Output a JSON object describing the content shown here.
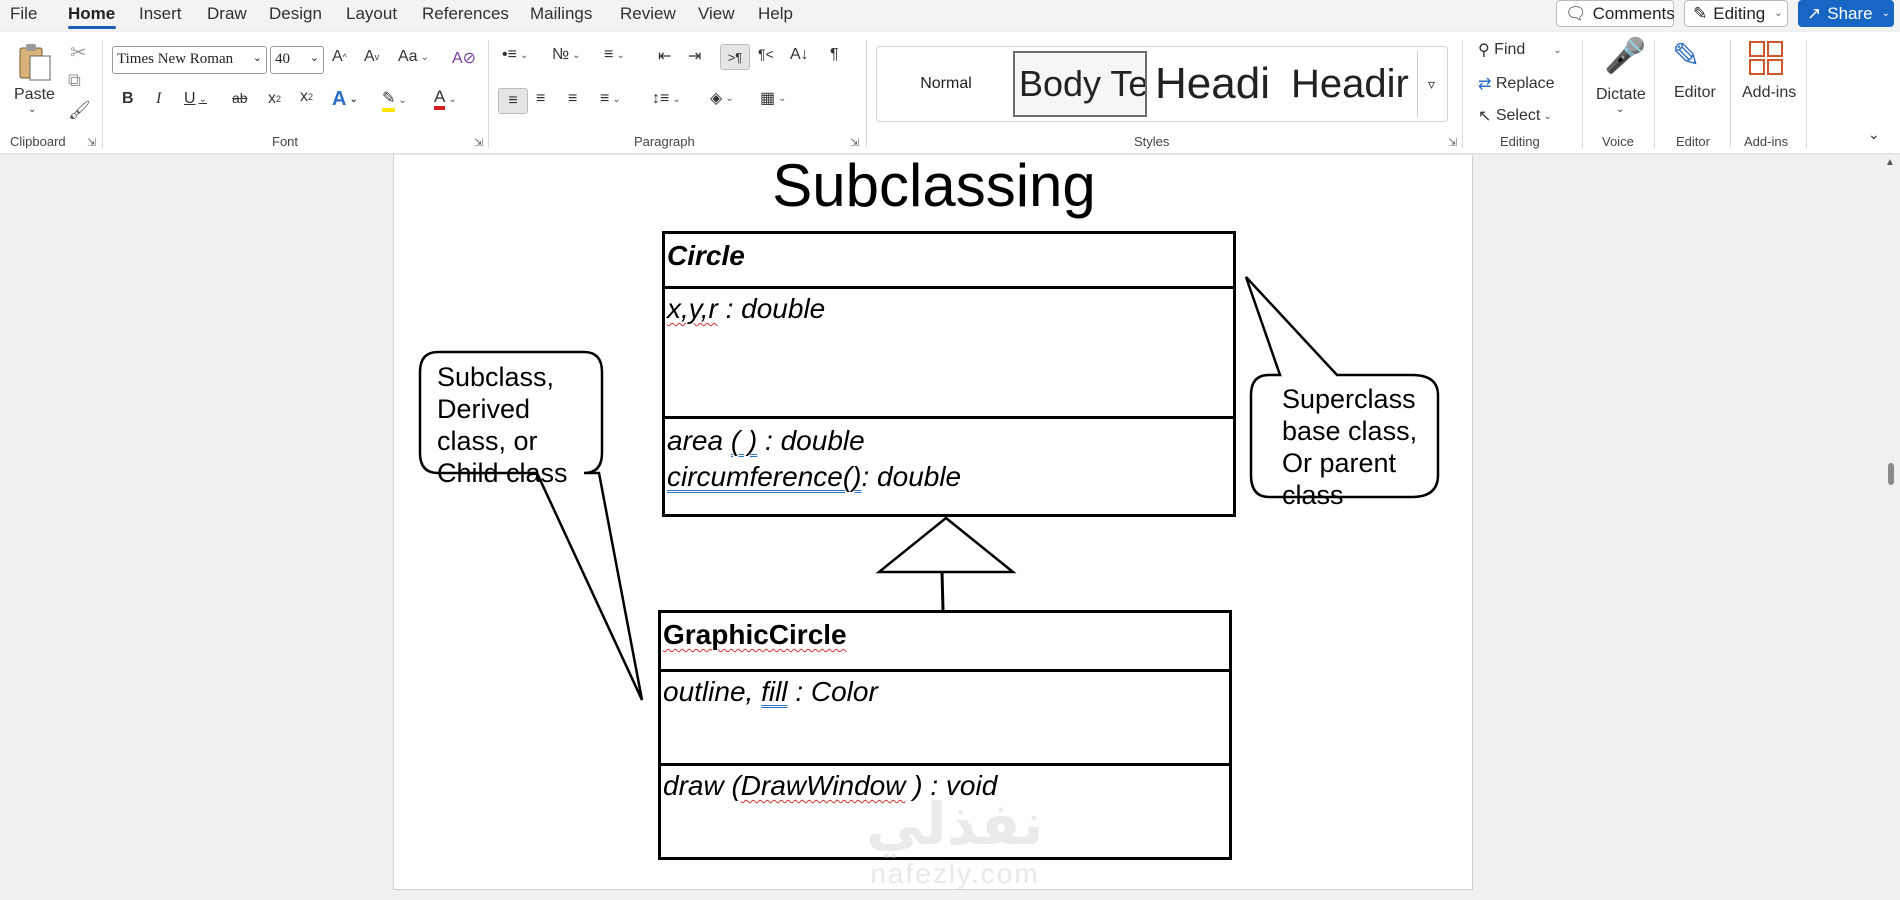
{
  "menu": {
    "items": [
      "File",
      "Home",
      "Insert",
      "Draw",
      "Design",
      "Layout",
      "References",
      "Mailings",
      "Review",
      "View",
      "Help"
    ],
    "active": "Home",
    "comments_label": "Comments",
    "editing_label": "Editing",
    "share_label": "Share"
  },
  "ribbon": {
    "clipboard": {
      "paste_label": "Paste",
      "group_label": "Clipboard"
    },
    "font": {
      "name": "Times New Roman",
      "size": "40",
      "group_label": "Font",
      "change_case": "Aa"
    },
    "paragraph": {
      "group_label": "Paragraph"
    },
    "styles": {
      "group_label": "Styles",
      "items": [
        "Normal",
        "Body Te",
        "Headi",
        "Headir"
      ]
    },
    "editing": {
      "find_label": "Find",
      "replace_label": "Replace",
      "select_label": "Select",
      "group_label": "Editing"
    },
    "voice": {
      "dictate_label": "Dictate",
      "group_label": "Voice"
    },
    "editor": {
      "editor_label": "Editor",
      "group_label": "Editor"
    },
    "addins": {
      "addins_label": "Add-ins",
      "group_label": "Add-ins"
    }
  },
  "document": {
    "title": "Subclassing",
    "superclass": {
      "name": "Circle",
      "attributes_prefix": "x,y,r",
      "attributes_suffix": ": double",
      "method1_name": "area",
      "method1_parens": "( )",
      "method1_type": ": double",
      "method2_name": "circumference()",
      "method2_type": ": double"
    },
    "subclass": {
      "name": "GraphicCircle",
      "attributes_a": "outline,",
      "attributes_b": "fill",
      "attributes_type": ": Color",
      "method_name": "draw (",
      "method_param": "DrawWindow",
      "method_close": ")",
      "method_type": ": void"
    },
    "callout_left": [
      "Subclass,",
      "Derived",
      "class, or",
      "Child class"
    ],
    "callout_right": [
      "Superclass",
      "base class,",
      "Or parent",
      "class"
    ],
    "watermark_arabic": "نفذلي",
    "watermark_latin": "nafezly.com"
  },
  "colors": {
    "accent": "#1766c4",
    "menu_underline": "#1a5fb4",
    "page_bg": "#ffffff",
    "workspace_bg": "#f0f0f0"
  }
}
